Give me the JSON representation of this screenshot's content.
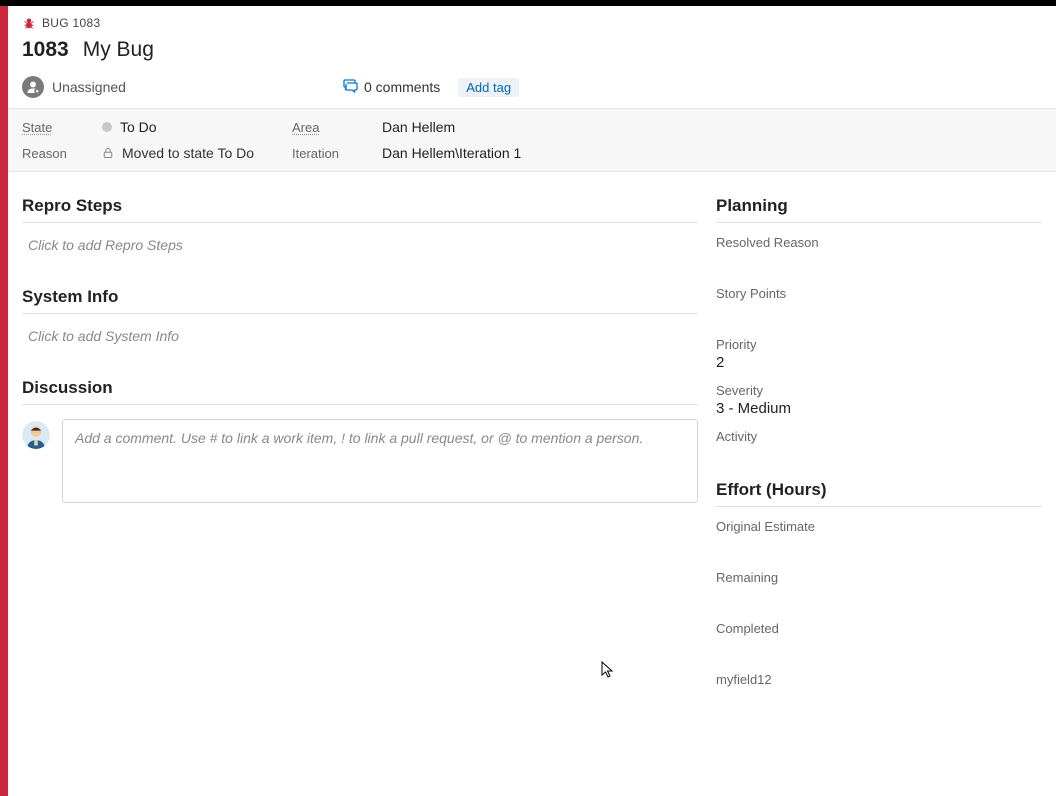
{
  "header": {
    "type_label": "BUG 1083",
    "id": "1083",
    "title": "My Bug",
    "assignee": "Unassigned",
    "comments_label": "0 comments",
    "add_tag_label": "Add tag"
  },
  "fields": {
    "state_label": "State",
    "state_value": "To Do",
    "reason_label": "Reason",
    "reason_value": "Moved to state To Do",
    "area_label": "Area",
    "area_value": "Dan Hellem",
    "iteration_label": "Iteration",
    "iteration_value": "Dan Hellem\\Iteration 1"
  },
  "sections": {
    "repro_steps": {
      "title": "Repro Steps",
      "placeholder": "Click to add Repro Steps"
    },
    "system_info": {
      "title": "System Info",
      "placeholder": "Click to add System Info"
    },
    "discussion": {
      "title": "Discussion",
      "placeholder": "Add a comment. Use # to link a work item, ! to link a pull request, or @ to mention a person."
    }
  },
  "planning": {
    "title": "Planning",
    "resolved_reason": {
      "label": "Resolved Reason",
      "value": ""
    },
    "story_points": {
      "label": "Story Points",
      "value": ""
    },
    "priority": {
      "label": "Priority",
      "value": "2"
    },
    "severity": {
      "label": "Severity",
      "value": "3 - Medium"
    },
    "activity": {
      "label": "Activity",
      "value": ""
    }
  },
  "effort": {
    "title": "Effort (Hours)",
    "original_estimate": {
      "label": "Original Estimate",
      "value": ""
    },
    "remaining": {
      "label": "Remaining",
      "value": ""
    },
    "completed": {
      "label": "Completed",
      "value": ""
    },
    "custom": {
      "label": "myfield12",
      "value": ""
    }
  },
  "colors": {
    "accent_red": "#cc293d",
    "link_blue": "#0078d4"
  }
}
